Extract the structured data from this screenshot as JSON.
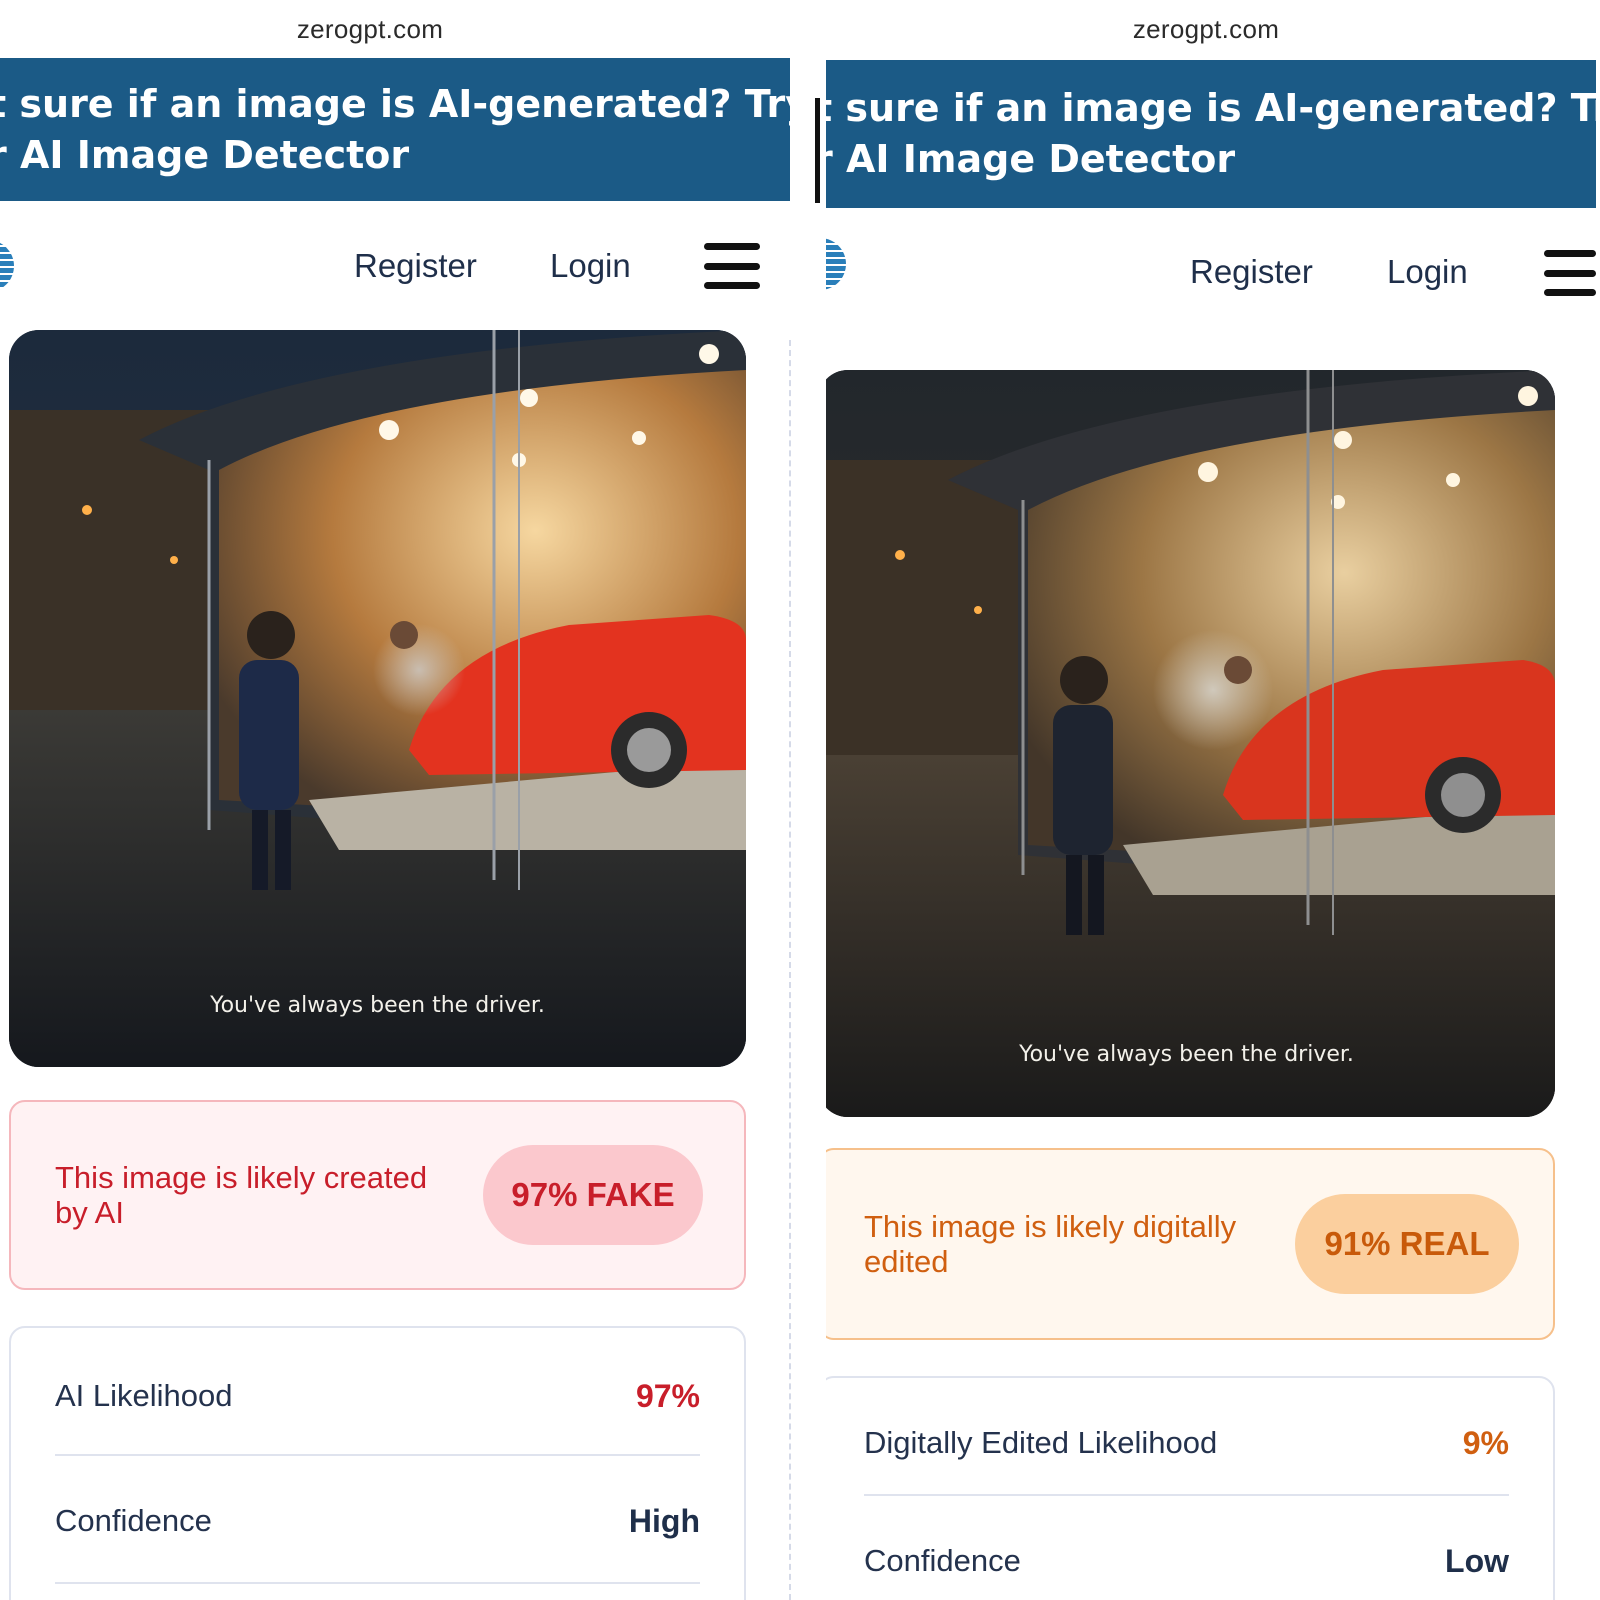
{
  "left": {
    "url": "zerogpt.com",
    "banner": {
      "line1": "t sure if an image is AI-generated? Try",
      "line2": "r AI Image Detector"
    },
    "nav": {
      "register": "Register",
      "login": "Login"
    },
    "image": {
      "caption": "You've always been the driver."
    },
    "verdict": {
      "text": "This image is likely created by AI",
      "badge": "97% FAKE"
    },
    "stats": [
      {
        "label": "AI Likelihood",
        "value": "97%"
      },
      {
        "label": "Confidence",
        "value": "High"
      }
    ]
  },
  "right": {
    "url": "zerogpt.com",
    "banner": {
      "line1": "t sure if an image is AI-generated? Try",
      "line2": "r AI Image Detector"
    },
    "nav": {
      "register": "Register",
      "login": "Login"
    },
    "image": {
      "caption": "You've always been the driver."
    },
    "verdict": {
      "text": "This image is likely digitally edited",
      "badge": "91% REAL"
    },
    "stats": [
      {
        "label": "Digitally Edited Likelihood",
        "value": "9%"
      },
      {
        "label": "Confidence",
        "value": "Low"
      }
    ]
  },
  "colors": {
    "banner": "#1b5a86",
    "fake_accent": "#c81e2a",
    "real_accent": "#d05f10",
    "fake_bg": "#fff2f3",
    "real_bg": "#fff7ee"
  },
  "icons": {
    "brand": "brain-logo-icon",
    "menu": "hamburger-menu-icon"
  }
}
